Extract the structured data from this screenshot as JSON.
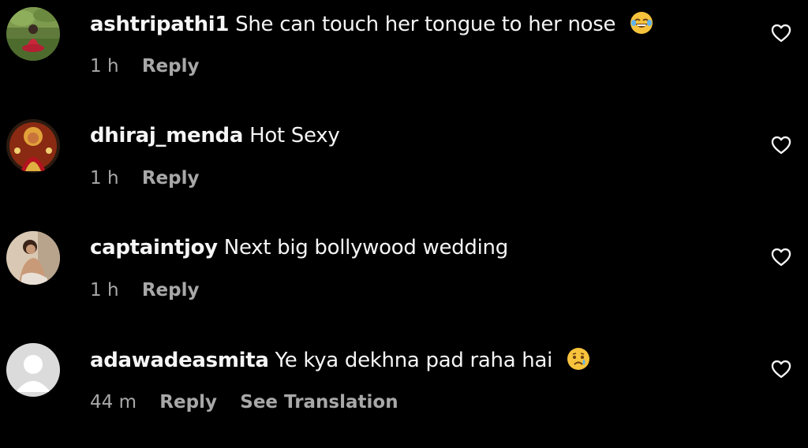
{
  "comments": [
    {
      "username": "ashtripathi1",
      "text": "She can touch her tongue to her nose",
      "emoji": "face-with-tears-of-joy",
      "time": "1 h",
      "reply_label": "Reply",
      "avatar": "photo-woman-in-red-on-grass"
    },
    {
      "username": "dhiraj_menda",
      "text": "Hot Sexy",
      "time": "1 h",
      "reply_label": "Reply",
      "avatar": "photo-deity-image"
    },
    {
      "username": "captaintjoy",
      "text": "Next big bollywood wedding",
      "time": "1 h",
      "reply_label": "Reply",
      "avatar": "photo-woman-posing"
    },
    {
      "username": "adawadeasmita",
      "text": "Ye kya dekhna pad raha hai",
      "emoji": "crying-face",
      "time": "44 m",
      "reply_label": "Reply",
      "translation_label": "See Translation",
      "avatar": "default-profile-placeholder"
    }
  ],
  "colors": {
    "background": "#000000",
    "primary_text": "#f5f5f5",
    "secondary_text": "#a8a8a8"
  },
  "icons": {
    "like": "heart-outline-icon"
  }
}
